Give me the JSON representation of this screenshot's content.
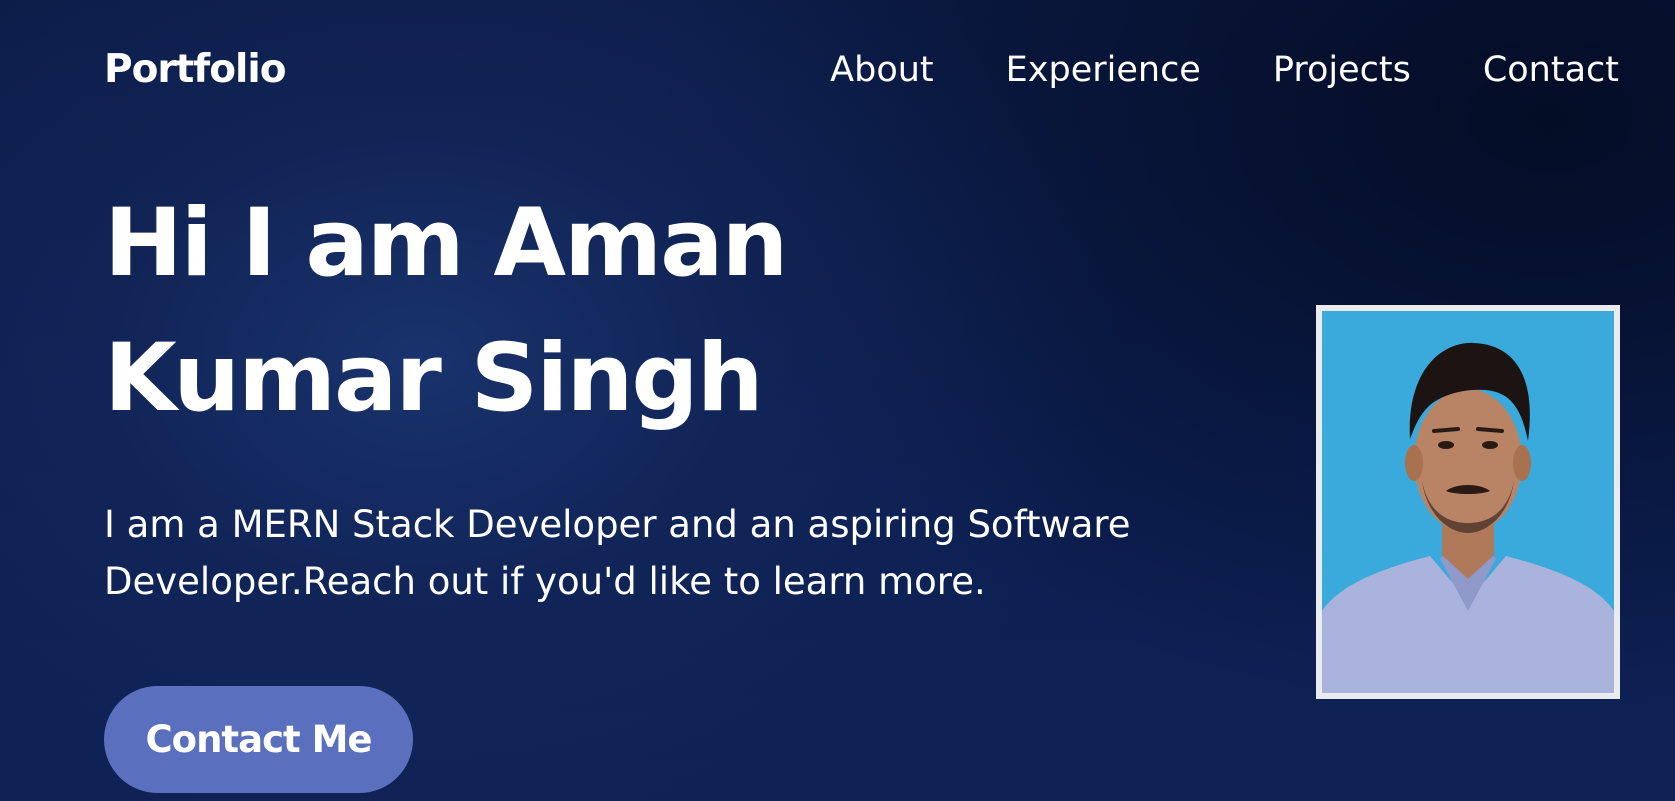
{
  "header": {
    "logo": "Portfolio",
    "nav": [
      {
        "label": "About"
      },
      {
        "label": "Experience"
      },
      {
        "label": "Projects"
      },
      {
        "label": "Contact"
      }
    ]
  },
  "hero": {
    "title": "Hi I am Aman Kumar Singh",
    "description": "I am a MERN Stack Developer and an aspiring Software Developer.Reach out if you'd like to learn more.",
    "cta_label": "Contact Me"
  },
  "colors": {
    "background": "#0c1f52",
    "button": "#5b6fbf",
    "text": "#ffffff",
    "photo_backdrop": "#3aa9db"
  }
}
